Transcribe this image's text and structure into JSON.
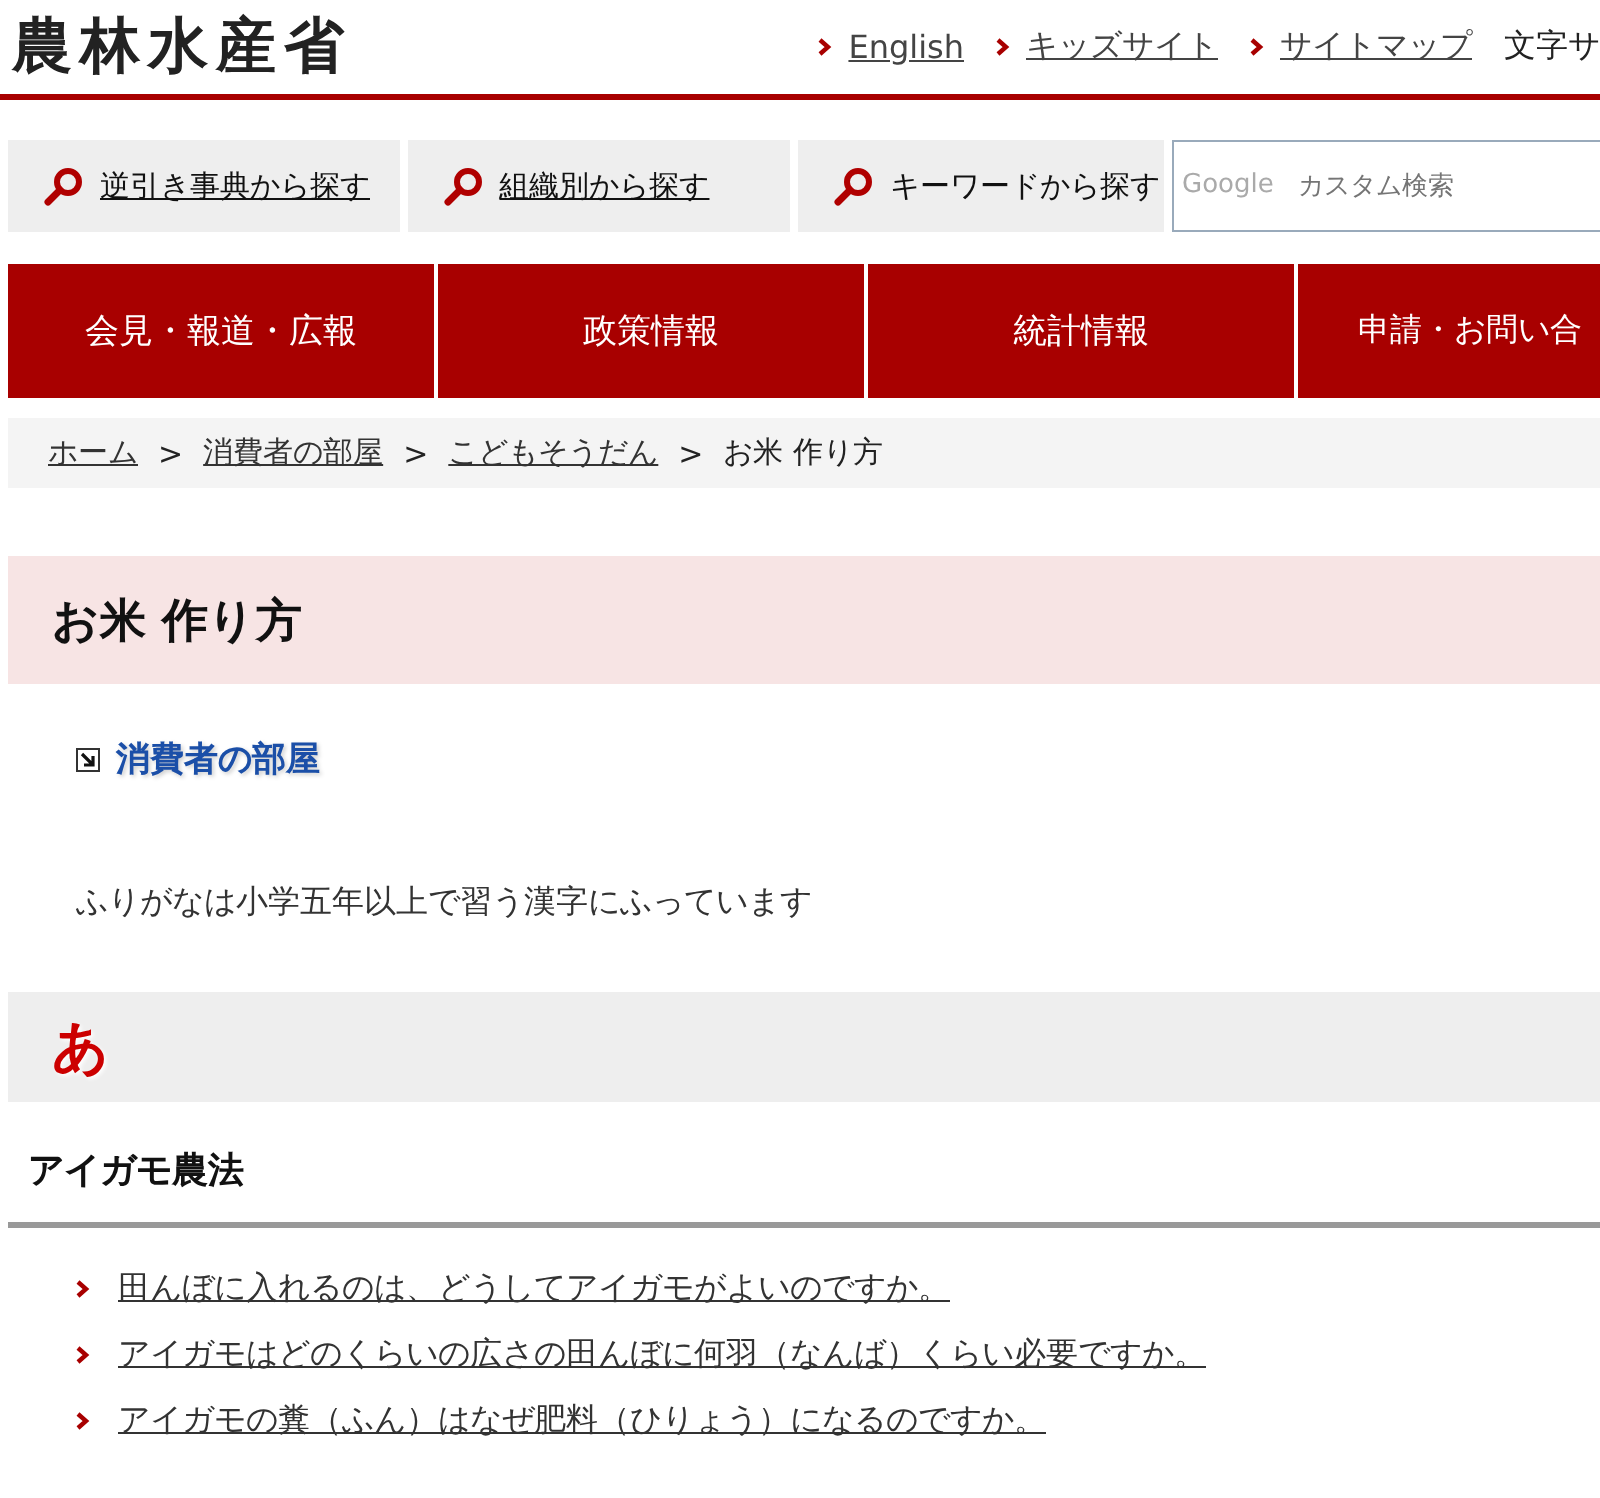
{
  "header": {
    "logo": "農林水産省",
    "links": [
      {
        "label": "English"
      },
      {
        "label": "キッズサイト"
      },
      {
        "label": "サイトマップ"
      }
    ],
    "text_size_label": "文字サ"
  },
  "search_tabs": [
    {
      "label": "逆引き事典から探す",
      "kind": "link"
    },
    {
      "label": "組織別から探す",
      "kind": "link"
    },
    {
      "label": "キーワードから探す",
      "kind": "plain"
    }
  ],
  "search": {
    "placeholder": "カスタム検索",
    "brand": "Google"
  },
  "nav": [
    {
      "label": "会見・報道・広報"
    },
    {
      "label": "政策情報"
    },
    {
      "label": "統計情報"
    },
    {
      "label": "申請・お問い合"
    }
  ],
  "breadcrumb_separator": ">",
  "breadcrumb": [
    {
      "label": "ホーム",
      "link": true
    },
    {
      "label": "消費者の部屋",
      "link": true
    },
    {
      "label": "こどもそうだん",
      "link": true
    },
    {
      "label": "お米 作り方",
      "link": false
    }
  ],
  "page_title": "お米 作り方",
  "related_link": "消費者の部屋",
  "note": "ふりがなは小学五年以上で習う漢字にふっています",
  "section": {
    "kana": "あ",
    "topics": [
      {
        "title": "アイガモ農法",
        "questions": [
          "田んぼに入れるのは、どうしてアイガモがよいのですか。",
          "アイガモはどのくらいの広さの田んぼに何羽（なんば）くらい必要ですか。",
          "アイガモの糞（ふん）はなぜ肥料（ひりょう）になるのですか。"
        ]
      }
    ]
  }
}
